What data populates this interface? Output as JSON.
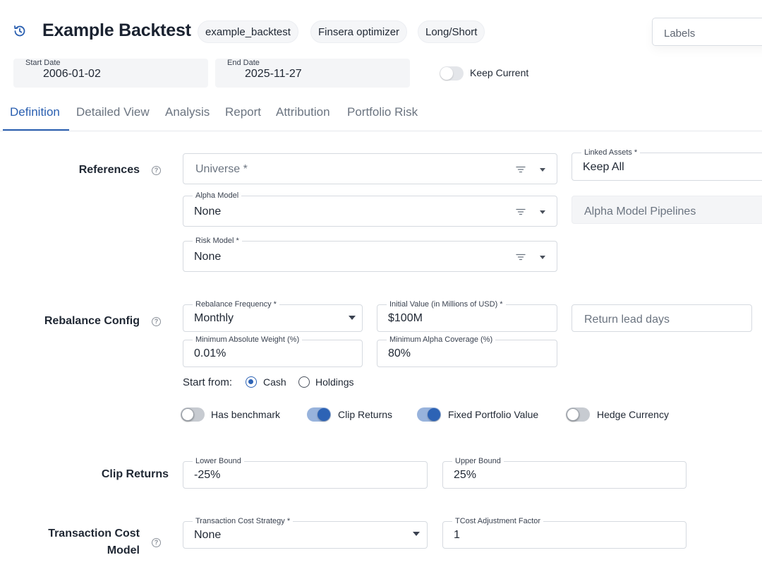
{
  "header": {
    "title": "Example Backtest",
    "chips": [
      "example_backtest",
      "Finsera optimizer",
      "Long/Short"
    ],
    "labels_placeholder": "Labels",
    "history_icon": "history-icon"
  },
  "dates": {
    "start_label": "Start Date",
    "start_value": "2006-01-02",
    "end_label": "End Date",
    "end_value": "2025-11-27",
    "keep_current_label": "Keep Current",
    "keep_current_on": false
  },
  "tabs": [
    {
      "label": "Definition",
      "active": true
    },
    {
      "label": "Detailed View",
      "active": false
    },
    {
      "label": "Analysis",
      "active": false
    },
    {
      "label": "Report",
      "active": false
    },
    {
      "label": "Attribution",
      "active": false
    },
    {
      "label": "Portfolio Risk",
      "active": false
    }
  ],
  "references": {
    "section_label": "References",
    "universe_placeholder": "Universe *",
    "linked_assets_label": "Linked Assets *",
    "linked_assets_value": "Keep All",
    "alpha_model_label": "Alpha Model",
    "alpha_model_value": "None",
    "alpha_pipelines_placeholder": "Alpha Model Pipelines",
    "risk_model_label": "Risk Model *",
    "risk_model_value": "None"
  },
  "rebalance": {
    "section_label": "Rebalance Config",
    "frequency_label": "Rebalance Frequency *",
    "frequency_value": "Monthly",
    "initial_value_label": "Initial Value (in Millions of USD) *",
    "initial_value": "$100M",
    "return_lead_placeholder": "Return lead days",
    "min_weight_label": "Minimum Absolute Weight (%)",
    "min_weight_value": "0.01%",
    "min_alpha_label": "Minimum Alpha Coverage (%)",
    "min_alpha_value": "80%",
    "start_from_label": "Start from:",
    "start_options": [
      {
        "label": "Cash",
        "checked": true
      },
      {
        "label": "Holdings",
        "checked": false
      }
    ],
    "toggles": [
      {
        "label": "Has benchmark",
        "on": false
      },
      {
        "label": "Clip Returns",
        "on": true
      },
      {
        "label": "Fixed Portfolio Value",
        "on": true
      },
      {
        "label": "Hedge Currency",
        "on": false
      }
    ]
  },
  "clip_returns": {
    "section_label": "Clip Returns",
    "lower_label": "Lower Bound",
    "lower_value": "-25%",
    "upper_label": "Upper Bound",
    "upper_value": "25%"
  },
  "transaction_cost": {
    "section_label_line1": "Transaction Cost",
    "section_label_line2": "Model",
    "strategy_label": "Transaction Cost Strategy *",
    "strategy_value": "None",
    "adjustment_label": "TCost Adjustment Factor",
    "adjustment_value": "1"
  },
  "colors": {
    "accent": "#2a5fb0",
    "toggle_on_track": "#98b3dc",
    "toggle_on_knob": "#2d63b5"
  }
}
